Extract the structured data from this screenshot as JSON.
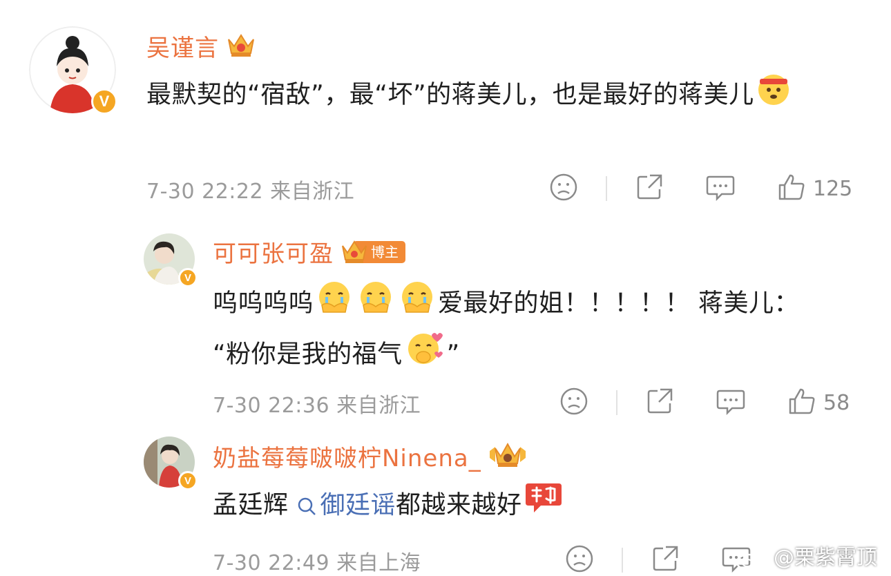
{
  "comments": [
    {
      "username": "吴谨言",
      "text_before": "最默契的“宿敌”，最“坏”的蒋美儿，也是最好的蒋美儿",
      "time": "7-30 22:22",
      "location": "来自浙江",
      "likes": "125"
    },
    {
      "username": "可可张可盈",
      "badge_label": "博主",
      "text_part1": "呜呜呜呜",
      "text_part2": "爱最好的姐！！！！！ 蒋美儿：",
      "text_part3": "“粉你是我的福气",
      "text_part4": "”",
      "time": "7-30 22:36",
      "location": "来自浙江",
      "likes": "58"
    },
    {
      "username": "奶盐莓莓啵啵柠Ninena_",
      "text_part1": "孟廷辉 ",
      "link_text": "御廷谣",
      "text_part2": "都越来越好",
      "time": "7-30 22:49",
      "location": "来自上海"
    }
  ],
  "watermark": "@栗紫霄顶",
  "colors": {
    "username": "#eb7340",
    "link": "#4a6fb5",
    "meta": "#9b9b9b",
    "badge": "#f5a623"
  }
}
